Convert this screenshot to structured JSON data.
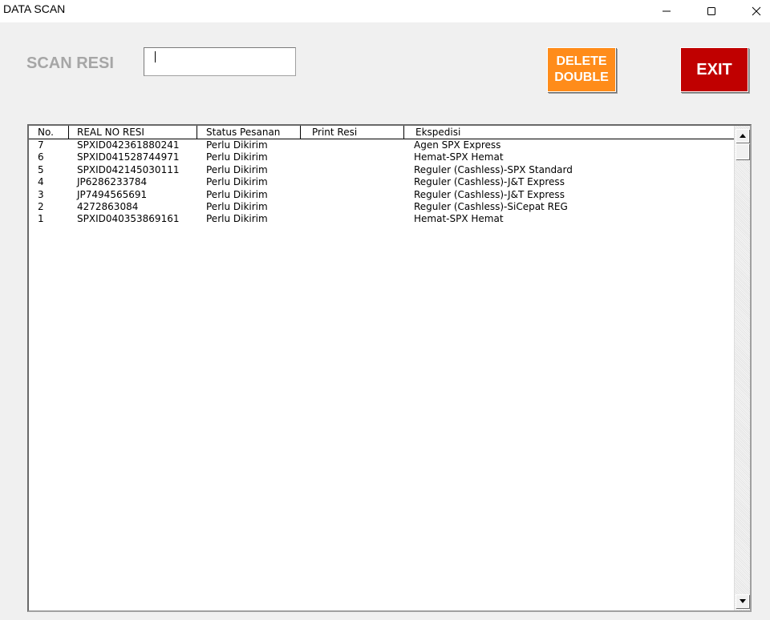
{
  "window": {
    "title": "DATA SCAN",
    "minimize_icon": "minimize-icon",
    "maximize_icon": "maximize-icon",
    "close_icon": "close-icon"
  },
  "form": {
    "scan_label": "SCAN RESI",
    "scan_input_value": "",
    "delete_button": "DELETE\nDOUBLE",
    "exit_button": "EXIT"
  },
  "colors": {
    "delete_button": "#ff8c1a",
    "exit_button": "#c00000",
    "label_gray": "#a6a6a6"
  },
  "list": {
    "columns": [
      "No.",
      "REAL NO RESI",
      "Status Pesanan",
      "Print Resi",
      "Ekspedisi"
    ],
    "rows": [
      {
        "no": "7",
        "resi": "SPXID042361880241",
        "status": "Perlu Dikirim",
        "print": "",
        "ekspedisi": "Agen SPX Express"
      },
      {
        "no": "6",
        "resi": "SPXID041528744971",
        "status": "Perlu Dikirim",
        "print": "",
        "ekspedisi": "Hemat-SPX Hemat"
      },
      {
        "no": "5",
        "resi": "SPXID042145030111",
        "status": "Perlu Dikirim",
        "print": "",
        "ekspedisi": "Reguler (Cashless)-SPX Standard"
      },
      {
        "no": "4",
        "resi": "JP6286233784",
        "status": "Perlu Dikirim",
        "print": "",
        "ekspedisi": "Reguler (Cashless)-J&T Express"
      },
      {
        "no": "3",
        "resi": "JP7494565691",
        "status": "Perlu Dikirim",
        "print": "",
        "ekspedisi": "Reguler (Cashless)-J&T Express"
      },
      {
        "no": "2",
        "resi": "4272863084",
        "status": "Perlu Dikirim",
        "print": "",
        "ekspedisi": "Reguler (Cashless)-SiCepat REG"
      },
      {
        "no": "1",
        "resi": "SPXID040353869161",
        "status": "Perlu Dikirim",
        "print": "",
        "ekspedisi": "Hemat-SPX Hemat"
      }
    ]
  }
}
